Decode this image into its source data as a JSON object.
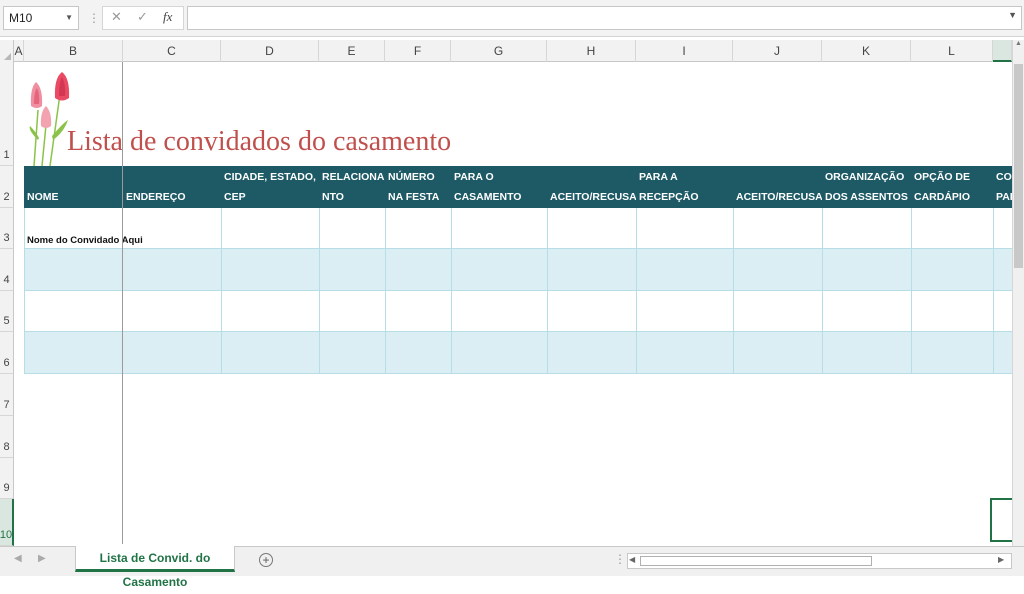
{
  "formula_bar": {
    "name_box": "M10",
    "cancel_icon": "✕",
    "enter_icon": "✓",
    "fx_label": "fx",
    "formula_value": ""
  },
  "columns": [
    "A",
    "B",
    "C",
    "D",
    "E",
    "F",
    "G",
    "H",
    "I",
    "J",
    "K",
    "L"
  ],
  "rows": [
    "1",
    "2",
    "3",
    "4",
    "5",
    "6",
    "7",
    "8",
    "9",
    "10"
  ],
  "sheet_title": "Lista de convidados do casamento",
  "table": {
    "headers": [
      "NOME",
      "ENDEREÇO",
      "CIDADE, ESTADO, CEP",
      "RELACIONAME NTO",
      "NÚMERO NA FESTA",
      "CONVIDADOS PARA O CASAMENTO",
      "ACEITO/RECUSADO",
      "CONVIDADOS PARA A RECEPÇÃO",
      "ACEITO/RECUSADO",
      "ORGANIZAÇÃO DOS ASSENTOS",
      "OPÇÃO DE CARDÁPIO",
      "CON PAR"
    ],
    "first_row_name": "Nome do Convidado Aqui"
  },
  "sheet_tab": "Lista de Convid. do Casamento",
  "colors": {
    "header_band": "#1d5a66",
    "title": "#c0504d",
    "stripe": "#daeef3",
    "accent": "#217346"
  },
  "icons": {
    "add_sheet": "⊕",
    "dropdown": "▾"
  }
}
